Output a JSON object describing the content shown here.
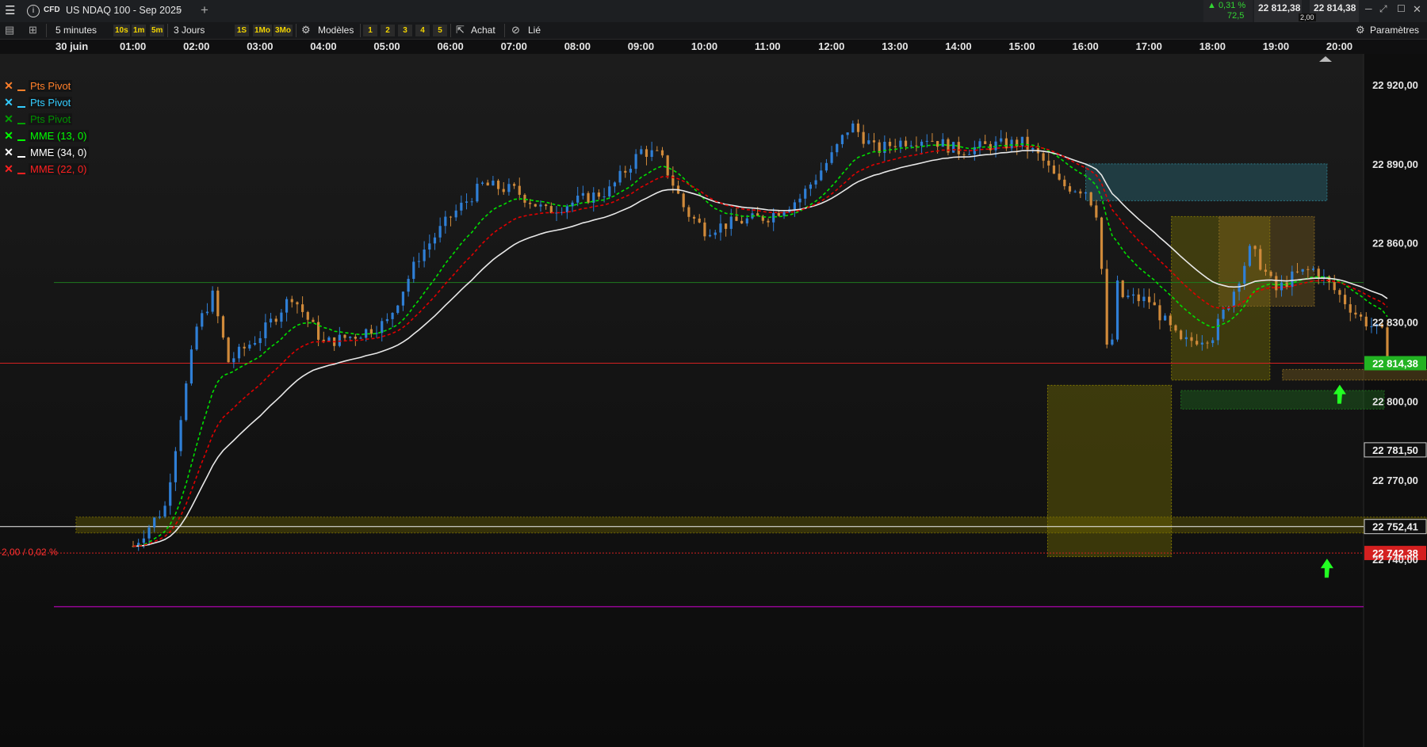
{
  "window": {
    "instrument_badge": "CFD",
    "instrument_name": "US NDAQ 100 - Sep 2025",
    "change_pct": "▲ 0,31 %",
    "change_pts": "72,5",
    "bid": "22 812,38",
    "ask": "22 814,38",
    "spread": "2,00",
    "icons": [
      "menu-icon",
      "info-icon",
      "search-icon",
      "plus-icon",
      "minimize-icon",
      "link-icon",
      "maximize-icon",
      "close-icon"
    ]
  },
  "toolbar": {
    "interval": "5 minutes",
    "quick_intervals": [
      "10s",
      "1m",
      "5m"
    ],
    "period": "3 Jours",
    "quick_periods": [
      "1S",
      "1Mo",
      "3Mo"
    ],
    "models_label": "Modèles",
    "slots": [
      "1",
      "2",
      "3",
      "4",
      "5"
    ],
    "buy_label": "Achat",
    "link_label": "Lié",
    "settings_label": "Paramètres"
  },
  "chart_data": {
    "type": "candlestick",
    "instrument": "US NDAQ 100 - Sep 2025",
    "interval": "5 minutes",
    "x_ticks": [
      "30 juin",
      "01:00",
      "02:00",
      "03:00",
      "04:00",
      "05:00",
      "06:00",
      "07:00",
      "08:00",
      "09:00",
      "10:00",
      "11:00",
      "12:00",
      "13:00",
      "14:00",
      "15:00",
      "16:00",
      "17:00",
      "18:00",
      "19:00",
      "20:00"
    ],
    "y_ticks": [
      "22 920,00",
      "22 890,00",
      "22 860,00",
      "22 830,00",
      "22 800,00",
      "22 770,00",
      "22 740,00"
    ],
    "ylim": [
      22720,
      22930
    ],
    "price_keypoints": [
      [
        0.0,
        22745
      ],
      [
        0.5,
        22760
      ],
      [
        0.9,
        22815
      ],
      [
        1.0,
        22828
      ],
      [
        1.25,
        22840
      ],
      [
        1.5,
        22815
      ],
      [
        2.0,
        22825
      ],
      [
        2.5,
        22840
      ],
      [
        3.0,
        22822
      ],
      [
        3.5,
        22825
      ],
      [
        4.0,
        22830
      ],
      [
        4.5,
        22855
      ],
      [
        5.0,
        22870
      ],
      [
        5.5,
        22882
      ],
      [
        6.0,
        22880
      ],
      [
        6.5,
        22872
      ],
      [
        7.0,
        22876
      ],
      [
        7.5,
        22880
      ],
      [
        8.0,
        22895
      ],
      [
        8.3,
        22893
      ],
      [
        8.7,
        22872
      ],
      [
        9.0,
        22865
      ],
      [
        9.5,
        22868
      ],
      [
        10.0,
        22870
      ],
      [
        10.5,
        22877
      ],
      [
        11.0,
        22893
      ],
      [
        11.3,
        22905
      ],
      [
        11.7,
        22895
      ],
      [
        12.0,
        22898
      ],
      [
        12.5,
        22900
      ],
      [
        13.0,
        22895
      ],
      [
        13.5,
        22897
      ],
      [
        14.0,
        22898
      ],
      [
        14.3,
        22892
      ],
      [
        14.6,
        22882
      ],
      [
        15.0,
        22880
      ],
      [
        15.2,
        22870
      ],
      [
        15.35,
        22810
      ],
      [
        15.5,
        22840
      ],
      [
        16.0,
        22838
      ],
      [
        16.5,
        22822
      ],
      [
        17.0,
        22825
      ],
      [
        17.3,
        22840
      ],
      [
        17.6,
        22858
      ],
      [
        18.0,
        22842
      ],
      [
        18.3,
        22848
      ],
      [
        18.6,
        22850
      ],
      [
        19.0,
        22840
      ],
      [
        19.3,
        22832
      ],
      [
        19.7,
        22825
      ],
      [
        19.82,
        22810
      ]
    ],
    "moving_averages": [
      {
        "name": "MME (13, 0)",
        "color": "#00e000",
        "style": "dashed"
      },
      {
        "name": "MME (34, 0)",
        "color": "#e8e8e8",
        "style": "solid"
      },
      {
        "name": "MME (22, 0)",
        "color": "#e00000",
        "style": "dashed"
      }
    ],
    "legend": [
      {
        "label": "Pts Pivot",
        "x_color": "#ff7f2a",
        "bar_color": "#ff7f2a",
        "text_color": "#ff7f2a"
      },
      {
        "label": "Pts Pivot",
        "x_color": "#33ccff",
        "bar_color": "#33ccff",
        "text_color": "#33ccff"
      },
      {
        "label": "Pts Pivot",
        "x_color": "#00a000",
        "bar_color": "#00a000",
        "text_color": "#009000"
      },
      {
        "label": "MME (13, 0)",
        "x_color": "#00ff00",
        "bar_color": "#00ff00",
        "text_color": "#00ff00"
      },
      {
        "label": "MME (34, 0)",
        "x_color": "#ffffff",
        "bar_color": "#ffffff",
        "text_color": "#ffffff"
      },
      {
        "label": "MME (22, 0)",
        "x_color": "#ff2020",
        "bar_color": "#ff2020",
        "text_color": "#ff2020"
      }
    ],
    "hlines": [
      {
        "y": 22845,
        "color": "#1f7a1f",
        "style": "solid"
      },
      {
        "y": 22814.38,
        "color": "#d42020",
        "style": "solid"
      },
      {
        "y": 22752.41,
        "color": "#f0f0f0",
        "style": "solid"
      },
      {
        "y": 22742.38,
        "color": "#d42020",
        "style": "dotted"
      },
      {
        "y": 22722,
        "color": "#d400d4",
        "style": "solid"
      }
    ],
    "zones": [
      {
        "x0": 15.0,
        "x1": 18.8,
        "y0": 22876,
        "y1": 22890,
        "color": "#2f7f8f"
      },
      {
        "x0": 14.4,
        "x1": 16.35,
        "y0": 22741,
        "y1": 22806,
        "color": "#8a8000"
      },
      {
        "x0": 16.35,
        "x1": 17.9,
        "y0": 22808,
        "y1": 22870,
        "color": "#8a8000"
      },
      {
        "x0": 17.1,
        "x1": 18.6,
        "y0": 22836,
        "y1": 22870,
        "color": "#8a6a20"
      },
      {
        "x0": 16.5,
        "x1": 19.7,
        "y0": 22797,
        "y1": 22804,
        "color": "#1f7a1f"
      },
      {
        "x0": 18.1,
        "x1": 20.7,
        "y0": 22808,
        "y1": 22812,
        "color": "#8a6a20"
      },
      {
        "x0": -0.9,
        "x1": 20.7,
        "y0": 22750,
        "y1": 22756,
        "color": "#7a7000"
      }
    ],
    "price_tags": [
      {
        "text": "22 920,00",
        "y": 22920,
        "type": "tick"
      },
      {
        "text": "22 890,00",
        "y": 22890,
        "type": "tick"
      },
      {
        "text": "22 860,00",
        "y": 22860,
        "type": "tick"
      },
      {
        "text": "22 830,00",
        "y": 22830,
        "type": "tick"
      },
      {
        "text": "22 814,38",
        "y": 22814.38,
        "type": "current",
        "bg": "#22b322",
        "fg": "#ffffff"
      },
      {
        "text": "22 800,00",
        "y": 22800,
        "type": "tick"
      },
      {
        "text": "22 781,50",
        "y": 22781.5,
        "type": "box",
        "bg": "#101010",
        "fg": "#f0f0f0"
      },
      {
        "text": "22 770,00",
        "y": 22770,
        "type": "tick"
      },
      {
        "text": "22 752,41",
        "y": 22752.41,
        "type": "box",
        "bg": "#101010",
        "fg": "#f0f0f0"
      },
      {
        "text": "22 742,38",
        "y": 22742.38,
        "type": "box",
        "bg": "#d42020",
        "fg": "#ffffff"
      },
      {
        "text": "22 740,00",
        "y": 22740,
        "type": "tick"
      }
    ],
    "annotation": {
      "text": "2,00 / 0,02 %",
      "color": "#ff3030",
      "y": 22742.38
    },
    "arrows": [
      {
        "x": 19.0,
        "y": 22802,
        "color": "#22ff22"
      },
      {
        "x": 18.8,
        "y": 22736,
        "color": "#22ff22"
      }
    ]
  }
}
